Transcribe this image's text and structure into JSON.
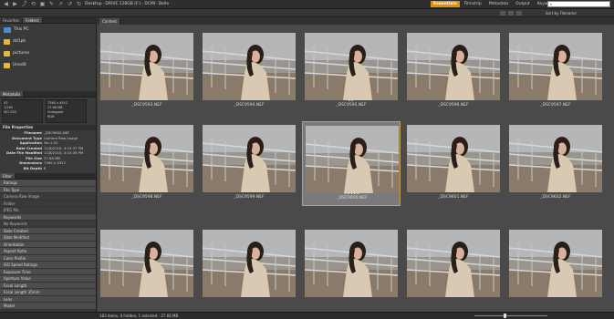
{
  "topbar": {
    "breadcrumb": [
      "Desktop",
      "DRIVE 128GB (F:)",
      "DCIM",
      "Belle"
    ],
    "workspaces": [
      "Essentials",
      "Filmstrip",
      "Metadata",
      "Output",
      "Keywo"
    ],
    "active_workspace": "Essentials",
    "search_placeholder": ""
  },
  "toolbar": {
    "sort_label": "Sort by Filename"
  },
  "left": {
    "tabs": [
      "Favorites",
      "Folders"
    ],
    "folders": [
      {
        "label": "This PC",
        "icon": "computer-icon"
      },
      {
        "label": "dd1ph",
        "icon": "folder-icon"
      },
      {
        "label": "pictures",
        "icon": "folder-icon"
      },
      {
        "label": "Unedit",
        "icon": "folder-icon"
      }
    ],
    "metadata_tab": "Metadata",
    "meta_box_left": [
      "f/2",
      "1/160",
      "ISO 250"
    ],
    "meta_box_right": [
      "7360 x 4912",
      "27.66 MB",
      "Untagged",
      "RGB"
    ],
    "file_properties_title": "File Properties",
    "file_properties": [
      {
        "key": "Filename",
        "value": "_DSC9600.NEF"
      },
      {
        "key": "Document Type",
        "value": "Camera Raw image"
      },
      {
        "key": "Application",
        "value": "Ver.1.02"
      },
      {
        "key": "Date Created",
        "value": "11/8/2015, 4:15:37 PM"
      },
      {
        "key": "Date File Modified",
        "value": "11/8/2015, 4:15:38 PM"
      },
      {
        "key": "File Size",
        "value": "27.66 MB"
      },
      {
        "key": "Dimensions",
        "value": "7360 x 4912"
      },
      {
        "key": "Bit Depth",
        "value": "8"
      }
    ],
    "filter_tab": "Filter",
    "filters": [
      {
        "label": "Ratings",
        "kind": "head"
      },
      {
        "label": "File Type",
        "kind": "head"
      },
      {
        "label": "Camera Raw image",
        "kind": "sub"
      },
      {
        "label": "Folder",
        "kind": "sub"
      },
      {
        "label": "JPEG file",
        "kind": "sub"
      },
      {
        "label": "Keywords",
        "kind": "head"
      },
      {
        "label": "No Keywords",
        "kind": "sub"
      },
      {
        "label": "Date Created",
        "kind": "head"
      },
      {
        "label": "Date Modified",
        "kind": "head"
      },
      {
        "label": "Orientation",
        "kind": "head"
      },
      {
        "label": "Aspect Ratio",
        "kind": "head"
      },
      {
        "label": "Color Profile",
        "kind": "head"
      },
      {
        "label": "ISO Speed Ratings",
        "kind": "head"
      },
      {
        "label": "Exposure Time",
        "kind": "head"
      },
      {
        "label": "Aperture Value",
        "kind": "head"
      },
      {
        "label": "Focal Length",
        "kind": "head"
      },
      {
        "label": "Focal Length 35mm",
        "kind": "head"
      },
      {
        "label": "Lens",
        "kind": "head"
      },
      {
        "label": "Model",
        "kind": "head"
      }
    ]
  },
  "content": {
    "tab": "Content",
    "thumbnails": [
      {
        "name": "",
        "stars": ""
      },
      {
        "name": "_DSC9594.NEF",
        "stars": ""
      },
      {
        "name": "_DSC9595.NEF",
        "stars": "••"
      },
      {
        "name": "_DSC9596.NEF",
        "stars": ""
      },
      {
        "name": "_DSC9597.NEF",
        "stars": ""
      },
      {
        "name": "_DSC9598.NEF",
        "stars": ""
      },
      {
        "name": "_DSC9599.NEF",
        "stars": ""
      },
      {
        "name": "_DSC9600.NEF",
        "stars": "•••••",
        "selected": true
      },
      {
        "name": "_DSC9601.NEF",
        "stars": ""
      },
      {
        "name": "_DSC9602.NEF",
        "stars": ""
      },
      {
        "name": "",
        "stars": ""
      },
      {
        "name": "",
        "stars": ""
      },
      {
        "name": "",
        "stars": ""
      },
      {
        "name": "",
        "stars": ""
      },
      {
        "name": "",
        "stars": ""
      }
    ],
    "first_name": "_DSC9593.NEF"
  },
  "status": {
    "text": "183 items, 0 hidden, 1 selected - 27.66 MB"
  }
}
